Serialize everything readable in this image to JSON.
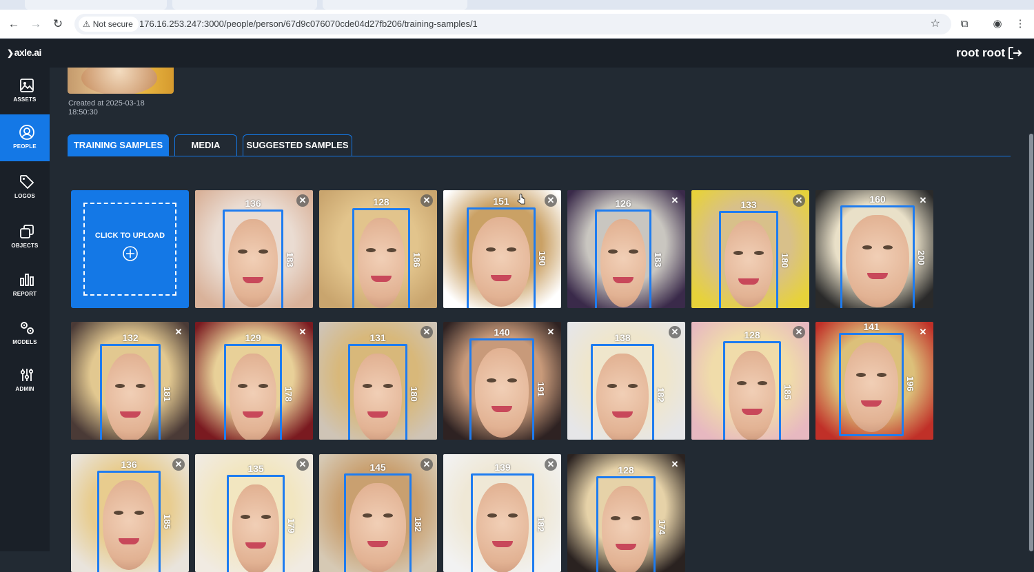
{
  "browser": {
    "not_secure_label": "Not secure",
    "url": "176.16.253.247:3000/people/person/67d9c076070cde04d27fb206/training-samples/1"
  },
  "header": {
    "logo": "axle.ai",
    "user_name": "root root"
  },
  "sidebar": {
    "items": [
      {
        "label": "ASSETS",
        "icon": "image-icon"
      },
      {
        "label": "PEOPLE",
        "icon": "person-icon",
        "active": true
      },
      {
        "label": "LOGOS",
        "icon": "tag-icon"
      },
      {
        "label": "OBJECTS",
        "icon": "objects-icon"
      },
      {
        "label": "REPORT",
        "icon": "bar-chart-icon"
      },
      {
        "label": "MODELS",
        "icon": "gears-icon"
      },
      {
        "label": "ADMIN",
        "icon": "sliders-icon"
      }
    ]
  },
  "person": {
    "created_line1": "Created at 2025-03-18",
    "created_line2": "18:50:30"
  },
  "tabs": [
    {
      "label": "TRAINING SAMPLES",
      "active": true
    },
    {
      "label": "MEDIA"
    },
    {
      "label": "SUGGESTED SAMPLES"
    }
  ],
  "upload": {
    "label": "CLICK TO UPLOAD"
  },
  "samples": [
    {
      "w": "136",
      "h": "183",
      "bg": "#d9b29a",
      "hair": "#eadcd2"
    },
    {
      "w": "128",
      "h": "186",
      "bg": "#c9a56e",
      "hair": "#e2c48c"
    },
    {
      "w": "151",
      "h": "190",
      "bg": "#ffffff",
      "hair": "#caa165"
    },
    {
      "w": "126",
      "h": "183",
      "bg": "#3a2a4a",
      "hair": "#c9c6c0"
    },
    {
      "w": "133",
      "h": "180",
      "bg": "#e7d23a",
      "hair": "#d8c08a"
    },
    {
      "w": "160",
      "h": "200",
      "bg": "#2a2a2a",
      "hair": "#e9e0c8"
    },
    {
      "w": "132",
      "h": "181",
      "bg": "#4a3a36",
      "hair": "#e2c890"
    },
    {
      "w": "129",
      "h": "178",
      "bg": "#7a1a20",
      "hair": "#e8d098"
    },
    {
      "w": "131",
      "h": "180",
      "bg": "#cfc4b6",
      "hair": "#d8b87a"
    },
    {
      "w": "140",
      "h": "191",
      "bg": "#2e2222",
      "hair": "#c89a7a"
    },
    {
      "w": "138",
      "h": "182",
      "bg": "#e6e6e8",
      "hair": "#efe6cc"
    },
    {
      "w": "128",
      "h": "185",
      "bg": "#e7b8c0",
      "hair": "#f0dcaa"
    },
    {
      "w": "141",
      "h": "196",
      "bg": "#c03028",
      "hair": "#dcc07a"
    },
    {
      "w": "136",
      "h": "185",
      "bg": "#e9e4dc",
      "hair": "#e8cc8e"
    },
    {
      "w": "135",
      "h": "179",
      "bg": "#f1ebe2",
      "hair": "#f2e6c0"
    },
    {
      "w": "145",
      "h": "182",
      "bg": "#d6c9b4",
      "hair": "#c9a070"
    },
    {
      "w": "139",
      "h": "182",
      "bg": "#f2f2f2",
      "hair": "#efe8d6"
    },
    {
      "w": "128",
      "h": "174",
      "bg": "#2a2220",
      "hair": "#e6d2a8"
    }
  ],
  "colors": {
    "accent": "#1478e6",
    "box": "#1e7cf0",
    "background": "#222a33",
    "sidebar": "#1a2028"
  }
}
